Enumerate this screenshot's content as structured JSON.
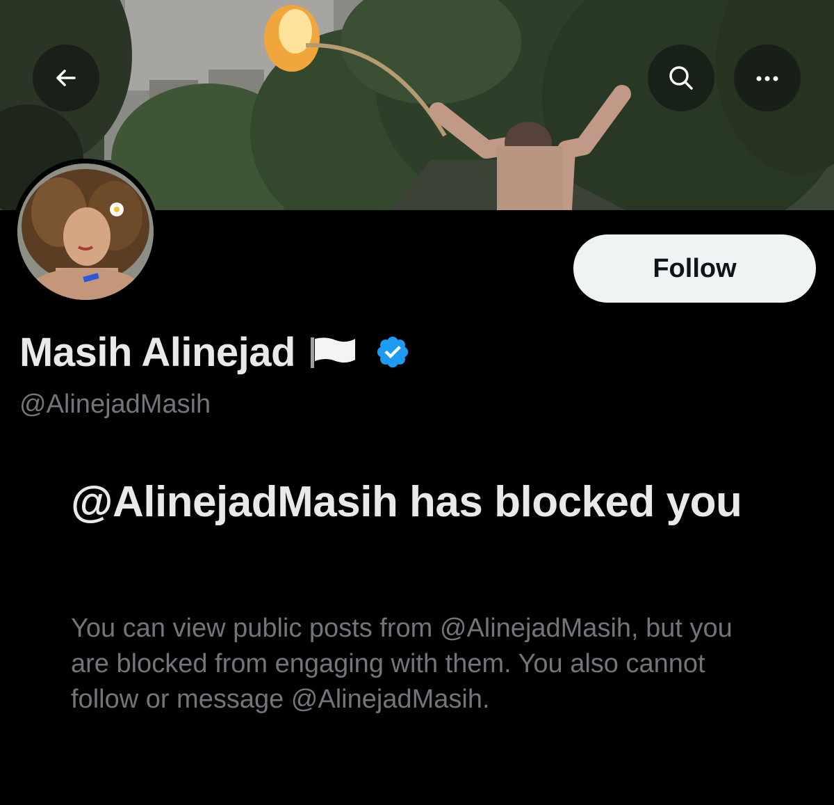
{
  "header": {
    "back_icon": "arrow-left-icon",
    "search_icon": "search-icon",
    "more_icon": "ellipsis-icon"
  },
  "profile": {
    "display_name": "Masih Alinejad",
    "name_emoji": "white-flag-icon",
    "verified_icon": "verified-badge-icon",
    "verified_color": "#1d9bf0",
    "handle": "@AlinejadMasih",
    "follow_label": "Follow"
  },
  "blocked_notice": {
    "title": "@AlinejadMasih has blocked you",
    "description": "You can view public posts from @AlinejadMasih, but you are blocked from engaging with them. You also cannot follow or message @AlinejadMasih."
  },
  "colors": {
    "background": "#000000",
    "primary_text": "#e7e9ea",
    "secondary_text": "#71767b",
    "button_bg": "#eff3f4"
  }
}
